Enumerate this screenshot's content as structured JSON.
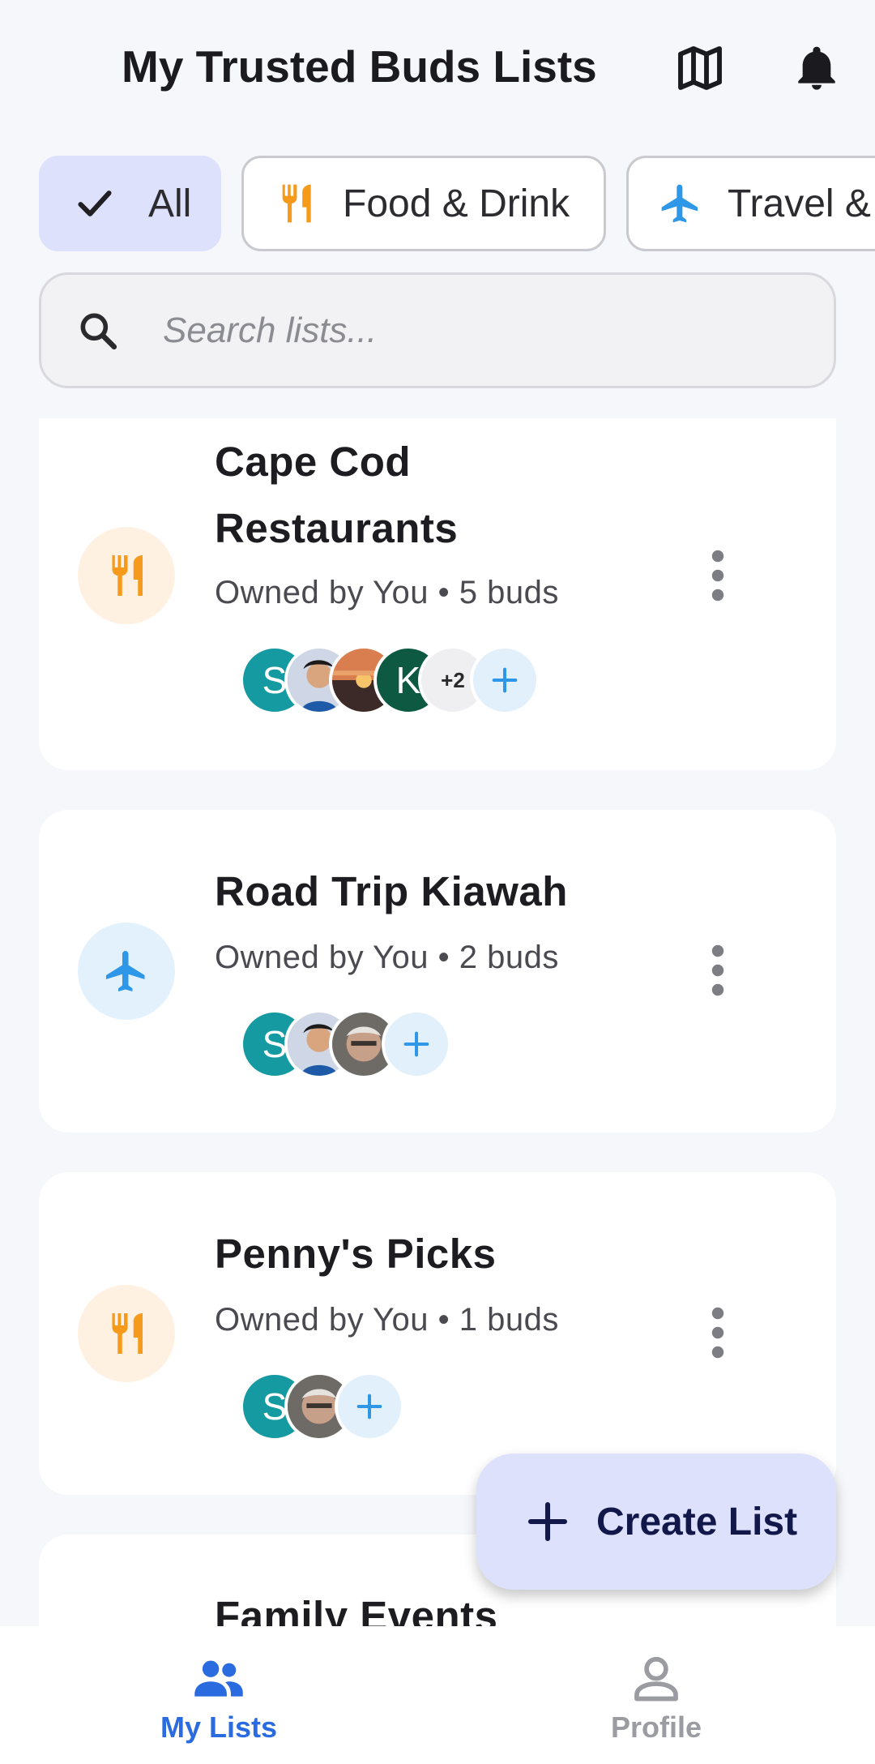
{
  "header": {
    "title": "My Trusted Buds Lists",
    "icons": [
      "map-icon",
      "bell-icon"
    ]
  },
  "filters": [
    {
      "label": "All",
      "icon": "check-icon",
      "selected": true
    },
    {
      "label": "Food & Drink",
      "icon": "fork-knife-icon",
      "selected": false
    },
    {
      "label": "Travel &",
      "icon": "airplane-icon",
      "selected": false
    }
  ],
  "search": {
    "placeholder": "Search lists..."
  },
  "lists": [
    {
      "title_line1": "Cape Cod",
      "title_line2": "Restaurants",
      "meta": "Owned by You • 5 buds",
      "category": "food",
      "avatars": [
        "S",
        "photo-boy",
        "photo-sunset",
        "K"
      ],
      "more_count": "+2"
    },
    {
      "title": "Road Trip Kiawah",
      "meta": "Owned by You • 2 buds",
      "category": "travel",
      "avatars": [
        "S",
        "photo-boy",
        "photo-man"
      ]
    },
    {
      "title": "Penny's Picks",
      "meta": "Owned by You • 1 buds",
      "category": "food",
      "avatars": [
        "S",
        "photo-man"
      ]
    },
    {
      "title": "Family Events",
      "meta": "",
      "category": ""
    }
  ],
  "fab": {
    "label": "Create List"
  },
  "bottom_nav": {
    "lists_label": "My Lists",
    "profile_label": "Profile"
  },
  "colors": {
    "accent": "#2b6be0",
    "chip_selected": "#dde1fb",
    "food": "#f59a1b",
    "travel": "#2f97e8",
    "avatar_teal": "#149aa0",
    "avatar_green": "#0d5942"
  }
}
